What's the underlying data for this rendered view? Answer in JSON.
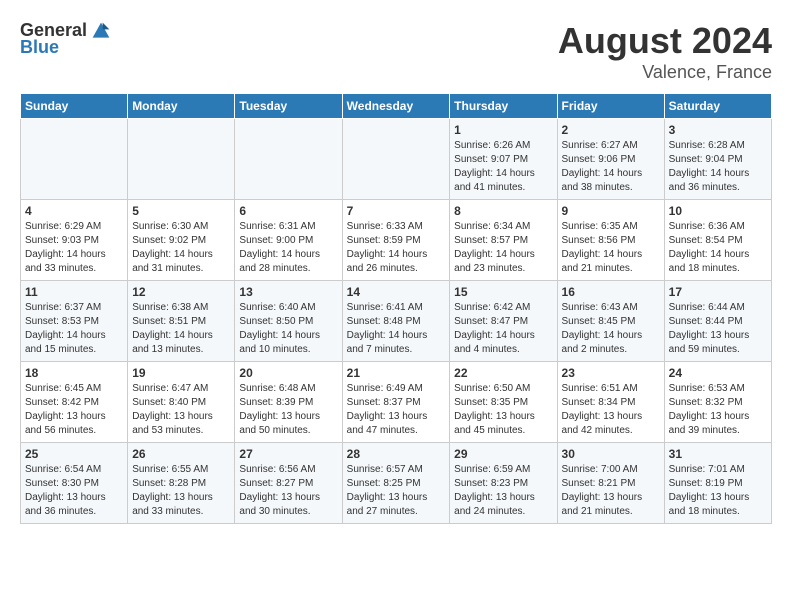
{
  "header": {
    "logo_general": "General",
    "logo_blue": "Blue",
    "month": "August 2024",
    "location": "Valence, France"
  },
  "weekdays": [
    "Sunday",
    "Monday",
    "Tuesday",
    "Wednesday",
    "Thursday",
    "Friday",
    "Saturday"
  ],
  "weeks": [
    [
      {
        "day": "",
        "info": ""
      },
      {
        "day": "",
        "info": ""
      },
      {
        "day": "",
        "info": ""
      },
      {
        "day": "",
        "info": ""
      },
      {
        "day": "1",
        "info": "Sunrise: 6:26 AM\nSunset: 9:07 PM\nDaylight: 14 hours and 41 minutes."
      },
      {
        "day": "2",
        "info": "Sunrise: 6:27 AM\nSunset: 9:06 PM\nDaylight: 14 hours and 38 minutes."
      },
      {
        "day": "3",
        "info": "Sunrise: 6:28 AM\nSunset: 9:04 PM\nDaylight: 14 hours and 36 minutes."
      }
    ],
    [
      {
        "day": "4",
        "info": "Sunrise: 6:29 AM\nSunset: 9:03 PM\nDaylight: 14 hours and 33 minutes."
      },
      {
        "day": "5",
        "info": "Sunrise: 6:30 AM\nSunset: 9:02 PM\nDaylight: 14 hours and 31 minutes."
      },
      {
        "day": "6",
        "info": "Sunrise: 6:31 AM\nSunset: 9:00 PM\nDaylight: 14 hours and 28 minutes."
      },
      {
        "day": "7",
        "info": "Sunrise: 6:33 AM\nSunset: 8:59 PM\nDaylight: 14 hours and 26 minutes."
      },
      {
        "day": "8",
        "info": "Sunrise: 6:34 AM\nSunset: 8:57 PM\nDaylight: 14 hours and 23 minutes."
      },
      {
        "day": "9",
        "info": "Sunrise: 6:35 AM\nSunset: 8:56 PM\nDaylight: 14 hours and 21 minutes."
      },
      {
        "day": "10",
        "info": "Sunrise: 6:36 AM\nSunset: 8:54 PM\nDaylight: 14 hours and 18 minutes."
      }
    ],
    [
      {
        "day": "11",
        "info": "Sunrise: 6:37 AM\nSunset: 8:53 PM\nDaylight: 14 hours and 15 minutes."
      },
      {
        "day": "12",
        "info": "Sunrise: 6:38 AM\nSunset: 8:51 PM\nDaylight: 14 hours and 13 minutes."
      },
      {
        "day": "13",
        "info": "Sunrise: 6:40 AM\nSunset: 8:50 PM\nDaylight: 14 hours and 10 minutes."
      },
      {
        "day": "14",
        "info": "Sunrise: 6:41 AM\nSunset: 8:48 PM\nDaylight: 14 hours and 7 minutes."
      },
      {
        "day": "15",
        "info": "Sunrise: 6:42 AM\nSunset: 8:47 PM\nDaylight: 14 hours and 4 minutes."
      },
      {
        "day": "16",
        "info": "Sunrise: 6:43 AM\nSunset: 8:45 PM\nDaylight: 14 hours and 2 minutes."
      },
      {
        "day": "17",
        "info": "Sunrise: 6:44 AM\nSunset: 8:44 PM\nDaylight: 13 hours and 59 minutes."
      }
    ],
    [
      {
        "day": "18",
        "info": "Sunrise: 6:45 AM\nSunset: 8:42 PM\nDaylight: 13 hours and 56 minutes."
      },
      {
        "day": "19",
        "info": "Sunrise: 6:47 AM\nSunset: 8:40 PM\nDaylight: 13 hours and 53 minutes."
      },
      {
        "day": "20",
        "info": "Sunrise: 6:48 AM\nSunset: 8:39 PM\nDaylight: 13 hours and 50 minutes."
      },
      {
        "day": "21",
        "info": "Sunrise: 6:49 AM\nSunset: 8:37 PM\nDaylight: 13 hours and 47 minutes."
      },
      {
        "day": "22",
        "info": "Sunrise: 6:50 AM\nSunset: 8:35 PM\nDaylight: 13 hours and 45 minutes."
      },
      {
        "day": "23",
        "info": "Sunrise: 6:51 AM\nSunset: 8:34 PM\nDaylight: 13 hours and 42 minutes."
      },
      {
        "day": "24",
        "info": "Sunrise: 6:53 AM\nSunset: 8:32 PM\nDaylight: 13 hours and 39 minutes."
      }
    ],
    [
      {
        "day": "25",
        "info": "Sunrise: 6:54 AM\nSunset: 8:30 PM\nDaylight: 13 hours and 36 minutes."
      },
      {
        "day": "26",
        "info": "Sunrise: 6:55 AM\nSunset: 8:28 PM\nDaylight: 13 hours and 33 minutes."
      },
      {
        "day": "27",
        "info": "Sunrise: 6:56 AM\nSunset: 8:27 PM\nDaylight: 13 hours and 30 minutes."
      },
      {
        "day": "28",
        "info": "Sunrise: 6:57 AM\nSunset: 8:25 PM\nDaylight: 13 hours and 27 minutes."
      },
      {
        "day": "29",
        "info": "Sunrise: 6:59 AM\nSunset: 8:23 PM\nDaylight: 13 hours and 24 minutes."
      },
      {
        "day": "30",
        "info": "Sunrise: 7:00 AM\nSunset: 8:21 PM\nDaylight: 13 hours and 21 minutes."
      },
      {
        "day": "31",
        "info": "Sunrise: 7:01 AM\nSunset: 8:19 PM\nDaylight: 13 hours and 18 minutes."
      }
    ]
  ]
}
